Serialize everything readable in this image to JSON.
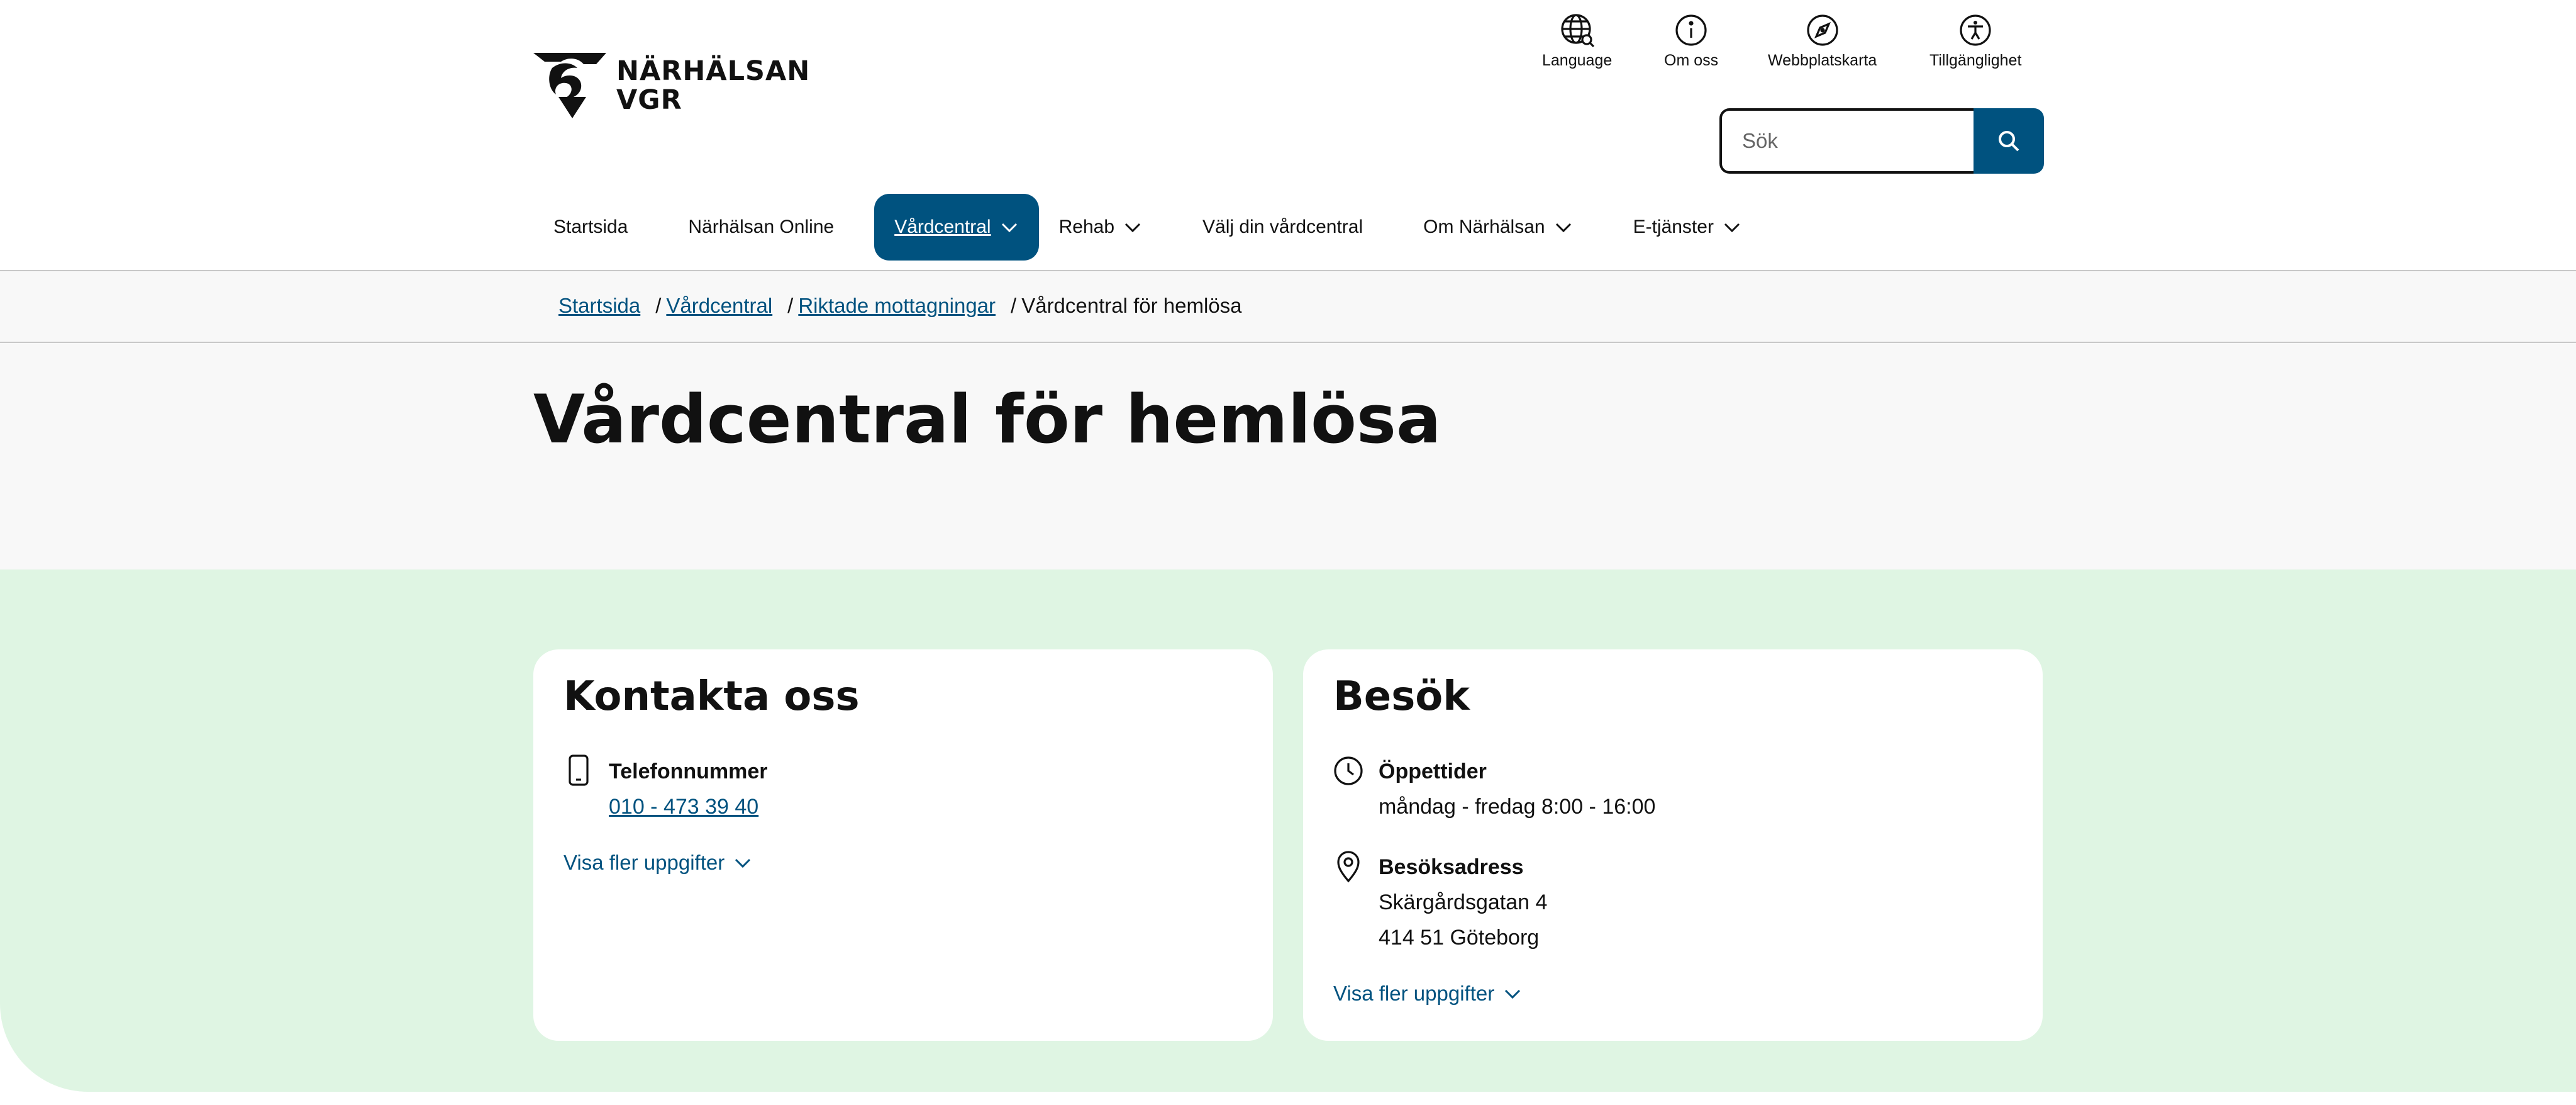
{
  "brand": {
    "name_line1": "NÄRHÄLSAN",
    "name_line2": "VGR"
  },
  "utility": [
    {
      "label": "Language",
      "icon": "globe-icon"
    },
    {
      "label": "Om oss",
      "icon": "info-icon"
    },
    {
      "label": "Webbplatskarta",
      "icon": "compass-icon"
    },
    {
      "label": "Tillgänglighet",
      "icon": "accessibility-icon"
    }
  ],
  "search": {
    "placeholder": "Sök",
    "button_icon": "search-icon"
  },
  "nav": [
    {
      "label": "Startsida"
    },
    {
      "label": "Närhälsan Online"
    },
    {
      "label": "Vårdcentral"
    },
    {
      "label": "Rehab"
    },
    {
      "label": "Välj din vårdcentral"
    },
    {
      "label": "Om Närhälsan"
    },
    {
      "label": "E-tjänster"
    }
  ],
  "breadcrumb": {
    "items": [
      "Startsida",
      "Vårdcentral",
      "Riktade mottagningar"
    ],
    "current": "Vårdcentral för hemlösa",
    "separator": "/"
  },
  "page": {
    "title": "Vårdcentral för hemlösa"
  },
  "contact": {
    "title": "Kontakta oss",
    "phone_label": "Telefonnummer",
    "phone_value": "010 - 473 39 40",
    "more_label": "Visa fler uppgifter"
  },
  "visit": {
    "title": "Besök",
    "hours_label": "Öppettider",
    "hours_value": "måndag - fredag 8:00 - 16:00",
    "address_label": "Besöksadress",
    "address_line1": "Skärgårdsgatan 4",
    "address_line2": "414 51 Göteborg",
    "more_label": "Visa fler uppgifter"
  },
  "colors": {
    "primary": "#00527f",
    "mint": "#dff5e3",
    "grey_band": "#f8f8f8"
  }
}
